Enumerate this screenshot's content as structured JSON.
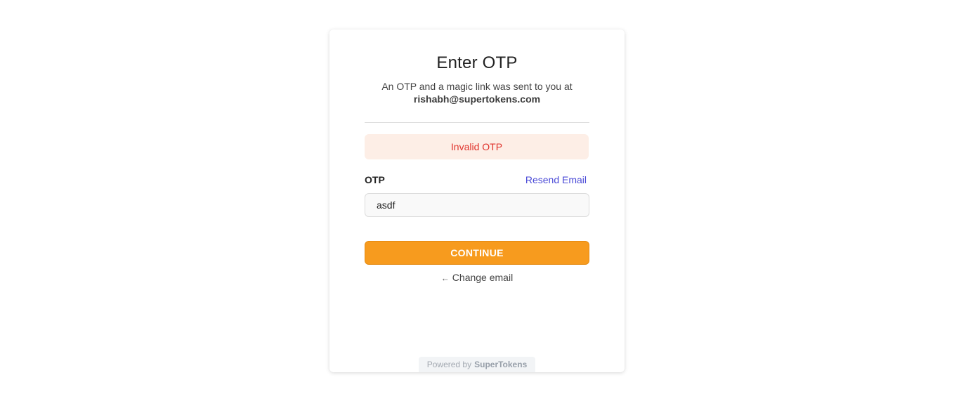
{
  "card": {
    "title": "Enter OTP",
    "subtitle": "An OTP and a magic link was sent to you at",
    "email": "rishabh@supertokens.com"
  },
  "error": {
    "message": "Invalid OTP"
  },
  "form": {
    "otp_label": "OTP",
    "resend_label": "Resend Email",
    "otp_value": "asdf",
    "continue_label": "CONTINUE",
    "change_email_arrow": "←",
    "change_email_label": "Change email"
  },
  "footer": {
    "powered_by": "Powered by",
    "brand": "SuperTokens"
  },
  "colors": {
    "accent": "#f79b1e",
    "error_text": "#e0332c",
    "error_bg": "#fdeee6",
    "link": "#4a4ad7"
  }
}
